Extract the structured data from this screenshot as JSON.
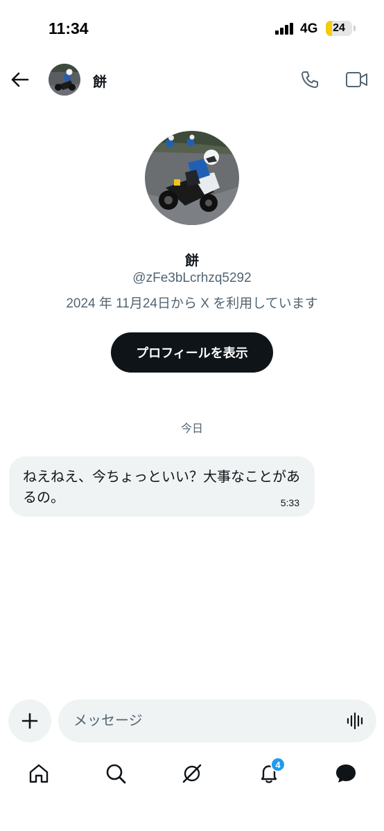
{
  "status_bar": {
    "time": "11:34",
    "network": "4G",
    "battery": "24",
    "battery_level_percent": 24,
    "icons": [
      "signal-icon",
      "battery-icon"
    ]
  },
  "header": {
    "name": "餅",
    "icons": [
      "back-arrow-icon",
      "phone-icon",
      "video-camera-icon"
    ]
  },
  "profile": {
    "name": "餅",
    "handle": "@zFe3bLcrhzq5292",
    "joined": "2024 年 11月24日から X を利用しています",
    "view_profile_label": "プロフィールを表示"
  },
  "conversation": {
    "date_separator": "今日",
    "messages": [
      {
        "text": "ねえねえ、今ちょっといい？大事なことがあるの。",
        "time": "5:33"
      }
    ]
  },
  "composer": {
    "placeholder": "メッセージ",
    "icons": [
      "plus-icon",
      "voice-waveform-icon"
    ]
  },
  "bottom_nav": {
    "items": [
      "home-icon",
      "search-icon",
      "grok-icon",
      "notifications-icon",
      "messages-icon"
    ],
    "notification_badge": "4"
  },
  "colors": {
    "primary_text": "#0f1419",
    "secondary_text": "#536471",
    "bubble_bg": "#eff3f4",
    "button_bg": "#0f1419",
    "badge": "#1d9bf0",
    "battery_fill": "#f5cc0a"
  }
}
